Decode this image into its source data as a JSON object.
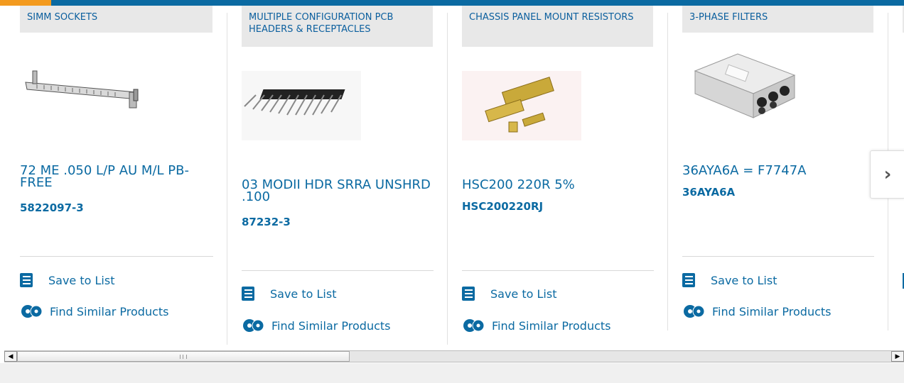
{
  "colors": {
    "accent": "#f39a1e",
    "brand_blue": "#0b6aa2",
    "category_bg": "#e8e8e8"
  },
  "products": [
    {
      "category": "SIMM SOCKETS",
      "name": "72 ME .050 L/P AU M/L PB-FREE",
      "part_number": "5822097-3",
      "image_icon": "simm-socket-image"
    },
    {
      "category": "MULTIPLE CONFIGURATION PCB HEADERS & RECEPTACLES",
      "name": "03 MODII HDR SRRA UNSHRD .100",
      "part_number": "87232-3",
      "image_icon": "pcb-header-image"
    },
    {
      "category": "CHASSIS PANEL MOUNT RESISTORS",
      "name": "HSC200 220R 5%",
      "part_number": "HSC200220RJ",
      "image_icon": "chassis-resistor-image"
    },
    {
      "category": "3-PHASE FILTERS",
      "name": "36AYA6A = F7747A",
      "part_number": "36AYA6A",
      "image_icon": "three-phase-filter-image"
    }
  ],
  "actions": {
    "save_label": "Save to List",
    "similar_label": "Find Similar Products"
  },
  "nav": {
    "next_label": "›"
  },
  "scrollbar": {
    "left_arrow": "◀",
    "right_arrow": "▶"
  }
}
